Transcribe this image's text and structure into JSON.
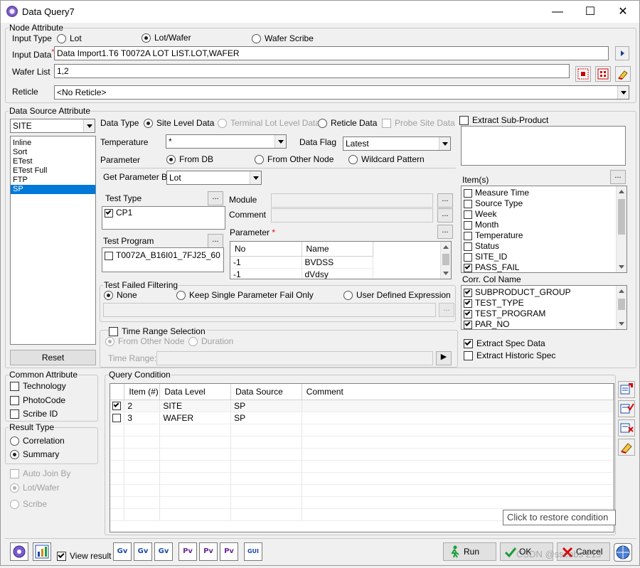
{
  "window": {
    "title": "Data Query7",
    "min": "—",
    "max": "☐",
    "close": "✕"
  },
  "node_attribute": {
    "label": "Node Attribute",
    "input_type_label": "Input Type",
    "input_types": [
      "Lot",
      "Lot/Wafer",
      "Wafer Scribe"
    ],
    "input_type_selected": "Lot/Wafer",
    "input_data_label": "Input Data",
    "input_data_value": "Data Import1.T6 T0072A LOT LIST.LOT,WAFER",
    "wafer_list_label": "Wafer List",
    "wafer_list_value": "1,2",
    "reticle_label": "Reticle",
    "reticle_value": "<No Reticle>"
  },
  "data_source": {
    "label": "Data Source Attribute",
    "source_select": "SITE",
    "sources": [
      "Inline",
      "Sort",
      "ETest",
      "ETest Full",
      "FTP",
      "SP"
    ],
    "source_selected": "SP",
    "reset_label": "Reset",
    "data_type_label": "Data Type",
    "data_types": [
      "Site Level Data",
      "Terminal Lot Level Data",
      "Reticle Data",
      "Probe Site Data"
    ],
    "temperature_label": "Temperature",
    "temperature_value": "*",
    "data_flag_label": "Data Flag",
    "data_flag_value": "Latest",
    "parameter_label": "Parameter",
    "parameter_modes": [
      "From DB",
      "From Other Node",
      "Wildcard Pattern"
    ],
    "get_param_by_label": "Get Parameter By",
    "get_param_by_value": "Lot",
    "test_type_label": "Test Type",
    "test_types": [
      {
        "label": "CP1",
        "checked": true
      }
    ],
    "test_program_label": "Test Program",
    "test_programs": [
      {
        "label": "T0072A_B16I01_7FJ25_60",
        "checked": false
      }
    ],
    "module_label": "Module",
    "comment_label": "Comment",
    "parameter_list_label": "Parameter",
    "param_columns": [
      "No",
      "Name"
    ],
    "param_rows": [
      [
        "-1",
        "BVDSS"
      ],
      [
        "-1",
        "dVdsy"
      ]
    ],
    "test_failed_label": "Test Failed Filtering",
    "fail_modes": [
      "None",
      "Keep Single Parameter Fail Only",
      "User Defined Expression"
    ],
    "time_range_label": "Time Range Selection",
    "time_modes": [
      "From Other Node",
      "Duration"
    ],
    "time_range_field_label": "Time Range:",
    "dots": "...",
    "go": "▶"
  },
  "right_panel": {
    "extract_sub_label": "Extract Sub-Product",
    "items_label": "Item(s)",
    "items": [
      {
        "label": "Measure Time",
        "checked": false
      },
      {
        "label": "Source Type",
        "checked": false
      },
      {
        "label": "Week",
        "checked": false
      },
      {
        "label": "Month",
        "checked": false
      },
      {
        "label": "Temperature",
        "checked": false
      },
      {
        "label": "Status",
        "checked": false
      },
      {
        "label": "SITE_ID",
        "checked": false
      },
      {
        "label": "PASS_FAIL",
        "checked": true
      }
    ],
    "corr_label": "Corr. Col Name",
    "corr_items": [
      {
        "label": "SUBPRODUCT_GROUP",
        "checked": true
      },
      {
        "label": "TEST_TYPE",
        "checked": true
      },
      {
        "label": "TEST_PROGRAM",
        "checked": true
      },
      {
        "label": "PAR_NO",
        "checked": true
      }
    ],
    "extract_spec_label": "Extract Spec Data",
    "extract_hist_label": "Extract Historic Spec"
  },
  "common_attr": {
    "label": "Common Attribute",
    "items": [
      "Technology",
      "PhotoCode",
      "Scribe ID"
    ]
  },
  "result_type": {
    "label": "Result Type",
    "options": [
      "Correlation",
      "Summary"
    ],
    "selected": "Summary"
  },
  "auto_join": {
    "label": "Auto Join By",
    "options": [
      "Lot/Wafer",
      "Scribe"
    ]
  },
  "query_condition": {
    "label": "Query Condition",
    "columns": [
      "Item (#)",
      "Data Level",
      "Data Source",
      "Comment"
    ],
    "rows": [
      {
        "checked": true,
        "item": "2",
        "level": "SITE",
        "source": "SP",
        "comment": ""
      },
      {
        "checked": false,
        "item": "3",
        "level": "WAFER",
        "source": "SP",
        "comment": ""
      }
    ],
    "tooltip": "Click to restore condition"
  },
  "toolbar": {
    "view_result_label": "View result",
    "gv_labels": [
      "Gv",
      "Gv",
      "Gv",
      "Pv",
      "Pv",
      "Pv",
      "GUI"
    ],
    "run_label": "Run",
    "ok_label": "OK",
    "cancel_label": "Cancel",
    "watermark": "CSDN @sscnbs 213"
  },
  "colors": {
    "selection": "#0078d7",
    "required": "#e00000",
    "run_green": "#1a9e3a"
  }
}
